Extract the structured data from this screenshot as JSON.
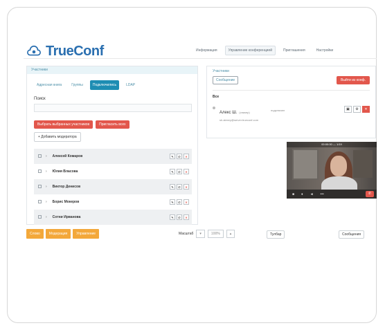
{
  "app": {
    "title": "TrueConf"
  },
  "topnav": {
    "items": [
      {
        "label": "Информация"
      },
      {
        "label": "Управление конференцией"
      },
      {
        "label": "Приглашения"
      },
      {
        "label": "Настройки"
      }
    ]
  },
  "left": {
    "header": "Участники",
    "tabs": [
      {
        "label": "Адресная книга"
      },
      {
        "label": "Группы"
      },
      {
        "label": "Подключились"
      },
      {
        "label": "LDAP"
      }
    ],
    "search_label": "Поиск",
    "search_placeholder": "",
    "actions": {
      "select_all": "Выбрать выбранных участников",
      "invite_all": "Пригласить всех",
      "add": "+ Добавить модератора"
    },
    "participants": [
      {
        "name": "Алексей Комаров"
      },
      {
        "name": "Юлия Власова"
      },
      {
        "name": "Виктор Денисов"
      },
      {
        "name": "Борис Мокеров"
      },
      {
        "name": "Сотни Ирванова"
      }
    ]
  },
  "bottom": {
    "buttons": [
      {
        "label": "Слово"
      },
      {
        "label": "Модерация"
      },
      {
        "label": "Управление"
      }
    ],
    "scale_label": "Масштаб",
    "scale_value": "100%",
    "tools_label": "Тулбар",
    "chat_label": "Сообщения"
  },
  "right": {
    "header": "Участники",
    "message_btn": "Сообщение",
    "red_btn": "Выйти из конф.",
    "group_label": "Все",
    "member": {
      "name": "Алекс Ш.",
      "role": "(спикер)",
      "email": "sh.alexey@server.trueconf.com",
      "status": "подключен"
    }
  },
  "video": {
    "title": "00:00:00 — 1/19"
  },
  "colors": {
    "brand_blue": "#2a6fb0",
    "accent_teal": "#1e8db3",
    "red": "#e2574c",
    "orange": "#f3a83a"
  }
}
